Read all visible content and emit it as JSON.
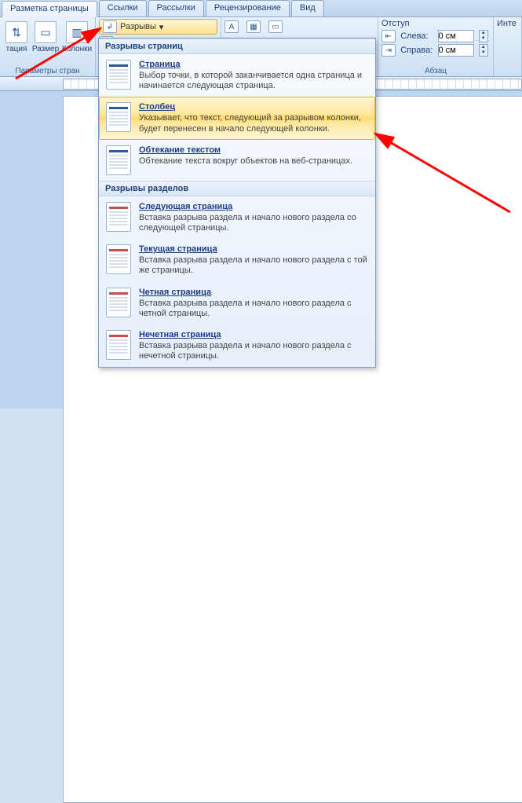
{
  "tabs": {
    "active": "Разметка страницы",
    "list": [
      "Разметка страницы",
      "Ссылки",
      "Рассылки",
      "Рецензирование",
      "Вид"
    ]
  },
  "ribbon": {
    "group1": {
      "btn_orientation": "тация",
      "btn_size": "Размер",
      "btn_columns": "Колонки",
      "label": "Параметры стран"
    },
    "breaks_btn": "Разрывы",
    "indent": {
      "header": "Отступ",
      "left_label": "Слева:",
      "left_value": "0 см",
      "right_label": "Справа:",
      "right_value": "0 см",
      "group_label": "Абзац"
    },
    "right_header": "Инте"
  },
  "dropdown": {
    "sections": [
      {
        "header": "Разрывы страниц",
        "items": [
          {
            "title": "Страница",
            "desc": "Выбор точки, в которой заканчивается одна страница и начинается следующая страница.",
            "highlight": false,
            "variant": "blue"
          },
          {
            "title": "Столбец",
            "desc": "Указывает, что текст, следующий за разрывом колонки, будет перенесен в начало следующей колонки.",
            "highlight": true,
            "variant": "blue"
          },
          {
            "title": "Обтекание текстом",
            "desc": "Обтекание текста вокруг объектов на веб-страницах.",
            "highlight": false,
            "variant": "blue"
          }
        ]
      },
      {
        "header": "Разрывы разделов",
        "items": [
          {
            "title": "Следующая страница",
            "desc": "Вставка разрыва раздела и начало нового раздела со следующей страницы.",
            "highlight": false,
            "variant": "red"
          },
          {
            "title": "Текущая страница",
            "desc": "Вставка разрыва раздела и начало нового раздела с той же страницы.",
            "highlight": false,
            "variant": "red"
          },
          {
            "title": "Четная страница",
            "desc": "Вставка разрыва раздела и начало нового раздела с четной страницы.",
            "highlight": false,
            "variant": "red"
          },
          {
            "title": "Нечетная страница",
            "desc": "Вставка разрыва раздела и начало нового раздела с нечетной страницы.",
            "highlight": false,
            "variant": "red"
          }
        ]
      }
    ]
  }
}
